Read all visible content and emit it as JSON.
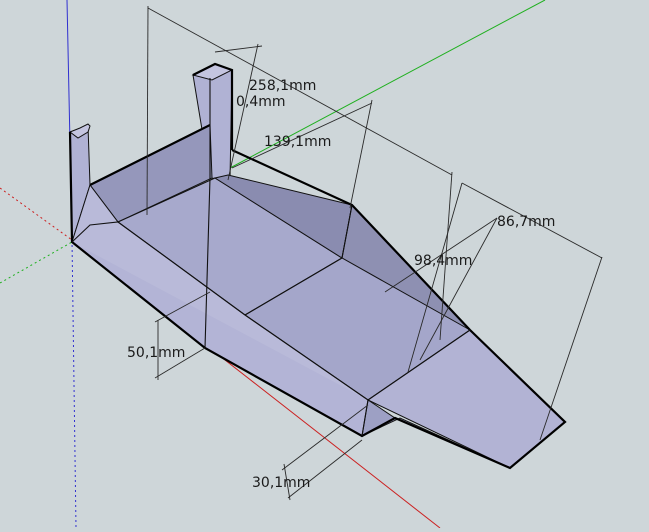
{
  "viewport": {
    "background": "#ced6d9",
    "face_light": "#b5b6d6",
    "face_mid": "#a6a8cc",
    "face_dark": "#8e90b3",
    "axis_red": "#cc2020",
    "axis_green": "#20b020",
    "axis_blue": "#3030d0"
  },
  "dimensions": {
    "d1": "258,1mm",
    "d2": "0,4mm",
    "d3": "139,1mm",
    "d4": "86,7mm",
    "d5": "98,4mm",
    "d6": "50,1mm",
    "d7": "30,1mm"
  }
}
